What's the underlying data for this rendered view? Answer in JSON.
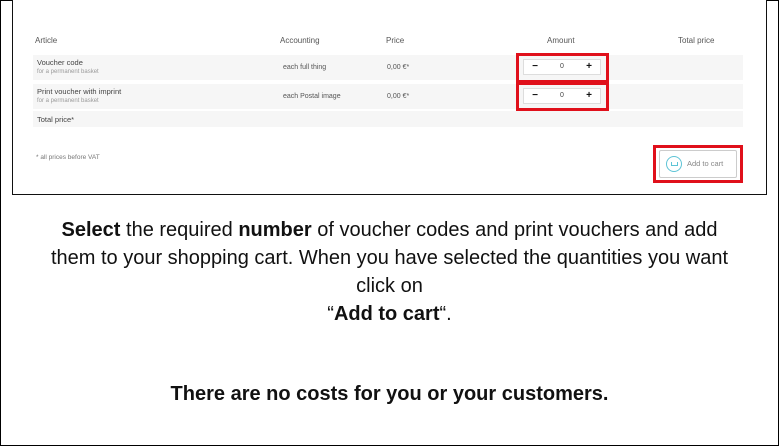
{
  "table": {
    "headers": {
      "article": "Article",
      "accounting": "Accounting",
      "price": "Price",
      "amount": "Amount",
      "total_price": "Total price"
    },
    "rows": [
      {
        "title": "Voucher code",
        "subtitle": "for a permanent basket",
        "accounting": "each full thing",
        "price": "0,00 €*",
        "quantity": "0"
      },
      {
        "title": "Print voucher with imprint",
        "subtitle": "for a permanent basket",
        "accounting": "each Postal image",
        "price": "0,00 €*",
        "quantity": "0"
      }
    ],
    "total_label": "Total price*"
  },
  "vat_note": "* all prices before VAT",
  "stepper": {
    "minus": "−",
    "plus": "+"
  },
  "cart_button": {
    "label": "Add to cart",
    "icon": "basket-icon"
  },
  "instructions": {
    "part1_bold": "Select",
    "part2": " the required ",
    "part3_bold": "number",
    "part4": " of voucher codes and print vouchers and add them to your shopping cart. When you have selected the quantities you want click on",
    "quote_open": "“",
    "part5_bold": "Add to cart",
    "quote_close": "“."
  },
  "no_costs": "There are no costs for you or your customers.",
  "colors": {
    "highlight": "#e0101b",
    "accent": "#5ec4d6"
  }
}
